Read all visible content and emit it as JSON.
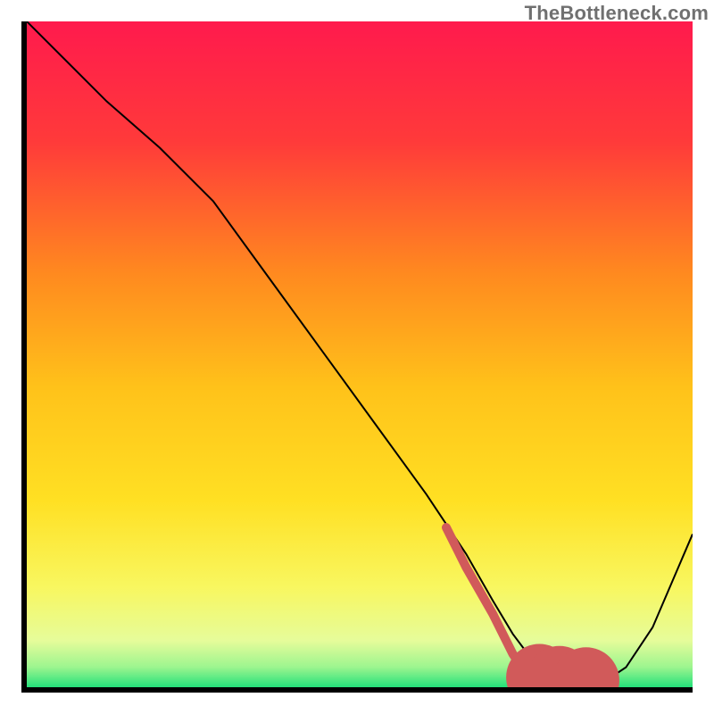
{
  "watermark": "TheBottleneck.com",
  "chart_data": {
    "type": "line",
    "title": "",
    "xlabel": "",
    "ylabel": "",
    "xlim": [
      0,
      100
    ],
    "ylim": [
      0,
      100
    ],
    "grid": false,
    "legend": false,
    "background_gradient_stops": [
      {
        "offset": 0.0,
        "color": "#ff1a4d"
      },
      {
        "offset": 0.18,
        "color": "#ff3a3a"
      },
      {
        "offset": 0.38,
        "color": "#ff8a1f"
      },
      {
        "offset": 0.55,
        "color": "#ffc21a"
      },
      {
        "offset": 0.72,
        "color": "#ffe023"
      },
      {
        "offset": 0.85,
        "color": "#f8f760"
      },
      {
        "offset": 0.93,
        "color": "#e6fc9a"
      },
      {
        "offset": 0.97,
        "color": "#9cf58f"
      },
      {
        "offset": 1.0,
        "color": "#24e07a"
      }
    ],
    "series": [
      {
        "name": "bottleneck-curve",
        "stroke": "#000000",
        "stroke_width": 2,
        "x": [
          0,
          6,
          12,
          20,
          28,
          36,
          44,
          52,
          60,
          66,
          70,
          73,
          76,
          80,
          83,
          87,
          90,
          94,
          97,
          100
        ],
        "y": [
          100,
          94,
          88,
          81,
          73,
          62,
          51,
          40,
          29,
          20,
          13,
          8,
          4,
          2,
          1,
          1,
          3,
          9,
          16,
          23
        ]
      },
      {
        "name": "highlight-segment",
        "stroke": "#d15a5a",
        "stroke_width": 10,
        "linecap": "round",
        "x": [
          63,
          66,
          70,
          73,
          75
        ],
        "y": [
          24,
          18,
          11,
          5,
          2
        ]
      }
    ],
    "markers": [
      {
        "name": "highlight-dot-1",
        "x": 77,
        "y": 1.5,
        "r": 5,
        "color": "#d15a5a"
      },
      {
        "name": "highlight-dot-2",
        "x": 80,
        "y": 1.2,
        "r": 5,
        "color": "#d15a5a"
      },
      {
        "name": "highlight-dot-3",
        "x": 84,
        "y": 1.0,
        "r": 5,
        "color": "#d15a5a"
      }
    ]
  }
}
